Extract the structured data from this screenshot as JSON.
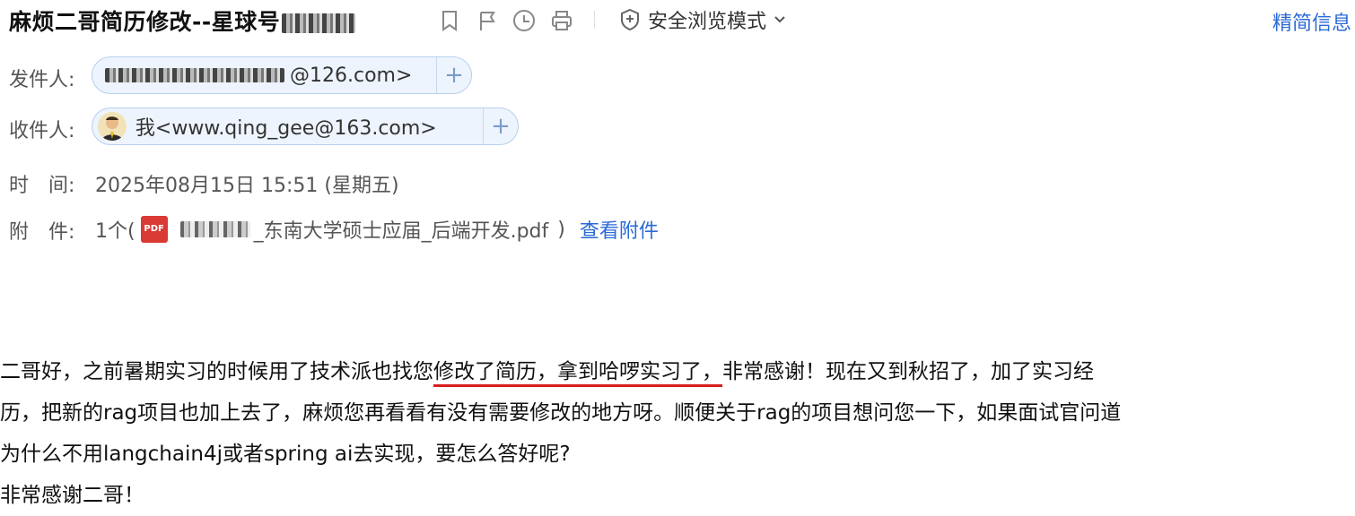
{
  "subject": {
    "title": "麻烦二哥简历修改--星球号"
  },
  "toolbar": {
    "safe_mode_label": "安全浏览模式",
    "simple_info_label": "精简信息"
  },
  "sender": {
    "label": "发件人:",
    "address": "@126.com>"
  },
  "recipient": {
    "label": "收件人:",
    "address": "我<www.qing_gee@163.com>"
  },
  "time": {
    "label": "时　间:",
    "value": "2025年08月15日 15:51 (星期五)"
  },
  "attachment": {
    "label": "附　件:",
    "count": "1个(",
    "file_suffix": "_东南大学硕士应届_后端开发.pdf",
    "close": ")",
    "view_link": "查看附件"
  },
  "message": {
    "line1_before": "二哥好，之前暑期实习的时候用了技术派也找您",
    "line1_highlight": "修改了简历，拿到哈啰实习了，",
    "line1_after": "非常感谢！现在又到秋招了，加了实习经",
    "line2": "历，把新的rag项目也加上去了，麻烦您再看看有没有需要修改的地方呀。顺便关于rag的项目想问您一下，如果面试官问道",
    "line3": "为什么不用langchain4j或者spring ai去实现，要怎么答好呢?",
    "line4": "非常感谢二哥！"
  }
}
